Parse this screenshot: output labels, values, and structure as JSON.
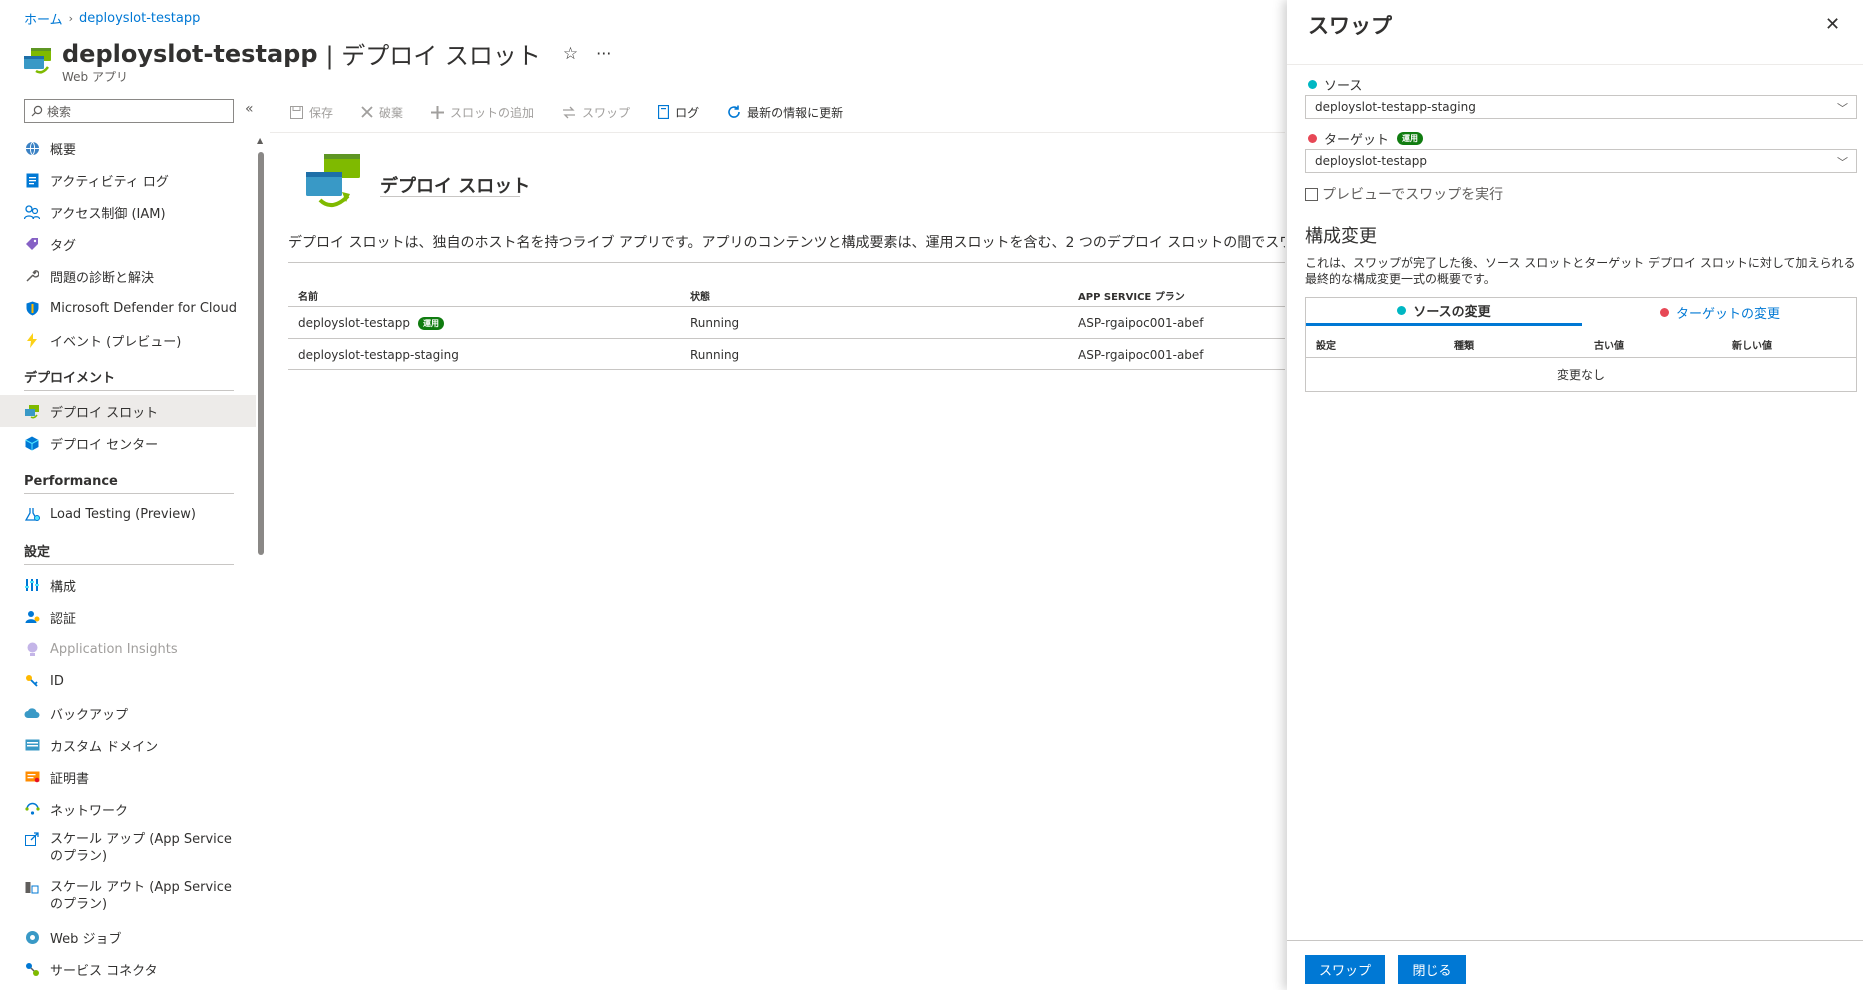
{
  "breadcrumb": {
    "home": "ホーム",
    "resource": "deployslot-testapp"
  },
  "header": {
    "resource_name": "deployslot-testapp",
    "separator": "|",
    "page_name": "デプロイ スロット",
    "resource_type": "Web アプリ",
    "star": "☆",
    "more": "···"
  },
  "sidebar": {
    "search_placeholder": "検索",
    "collapse": "«",
    "items_top": [
      {
        "label": "概要",
        "icon": "globe-icon"
      },
      {
        "label": "アクティビティ ログ",
        "icon": "log-icon"
      },
      {
        "label": "アクセス制御 (IAM)",
        "icon": "people-icon"
      },
      {
        "label": "タグ",
        "icon": "tag-icon"
      },
      {
        "label": "問題の診断と解決",
        "icon": "wrench-icon"
      },
      {
        "label": "Microsoft Defender for Cloud",
        "icon": "shield-icon"
      },
      {
        "label": "イベント (プレビュー)",
        "icon": "lightning-icon"
      }
    ],
    "section_deploy": "デプロイメント",
    "items_deploy": [
      {
        "label": "デプロイ スロット",
        "icon": "slots-icon"
      },
      {
        "label": "デプロイ センター",
        "icon": "cube-icon"
      }
    ],
    "section_perf": "Performance",
    "items_perf": [
      {
        "label": "Load Testing (Preview)",
        "icon": "flask-icon"
      }
    ],
    "section_settings": "設定",
    "items_settings": [
      {
        "label": "構成",
        "icon": "sliders-icon"
      },
      {
        "label": "認証",
        "icon": "auth-icon"
      },
      {
        "label": "Application Insights",
        "icon": "bulb-icon"
      },
      {
        "label": "ID",
        "icon": "key-icon"
      },
      {
        "label": "バックアップ",
        "icon": "cloud-icon"
      },
      {
        "label": "カスタム ドメイン",
        "icon": "domain-icon"
      },
      {
        "label": "証明書",
        "icon": "certificate-icon"
      },
      {
        "label": "ネットワーク",
        "icon": "network-icon"
      },
      {
        "label": "スケール アップ (App Service のプラン)",
        "icon": "scale-up-icon"
      },
      {
        "label": "スケール アウト (App Service のプラン)",
        "icon": "scale-out-icon"
      },
      {
        "label": "Web ジョブ",
        "icon": "webjob-icon"
      },
      {
        "label": "サービス コネクタ",
        "icon": "connector-icon"
      }
    ]
  },
  "toolbar": {
    "save": "保存",
    "discard": "破棄",
    "add_slot": "スロットの追加",
    "swap": "スワップ",
    "logs": "ログ",
    "refresh": "最新の情報に更新"
  },
  "main": {
    "hero_title": "デプロイ スロット",
    "description": "デプロイ スロットは、独自のホスト名を持つライブ アプリです。アプリのコンテンツと構成要素は、運用スロットを含む、2 つのデプロイ スロットの間でスワ",
    "table": {
      "headers": [
        "名前",
        "状態",
        "APP SERVICE プラン"
      ],
      "rows": [
        {
          "name": "deployslot-testapp",
          "badge": "運用",
          "status": "Running",
          "plan": "ASP-rgaipoc001-abef"
        },
        {
          "name": "deployslot-testapp-staging",
          "badge": "",
          "status": "Running",
          "plan": "ASP-rgaipoc001-abef"
        }
      ]
    }
  },
  "swap_panel": {
    "title": "スワップ",
    "close": "✕",
    "source_label": "ソース",
    "source_value": "deployslot-testapp-staging",
    "target_label": "ターゲット",
    "target_badge": "運用",
    "target_value": "deployslot-testapp",
    "preview_label": "プレビューでスワップを実行",
    "changes_title": "構成変更",
    "changes_desc": "これは、スワップが完了した後、ソース スロットとターゲット デプロイ スロットに対して加えられる最終的な構成変更一式の概要です。",
    "tab_source": "ソースの変更",
    "tab_target": "ターゲットの変更",
    "columns": [
      "設定",
      "種類",
      "古い値",
      "新しい値"
    ],
    "no_changes": "変更なし",
    "swap_button": "スワップ",
    "close_button": "閉じる"
  },
  "colors": {
    "accent": "#0078d4",
    "source_dot": "#00b7c3",
    "target_dot": "#e74856",
    "badge": "#107c10"
  }
}
